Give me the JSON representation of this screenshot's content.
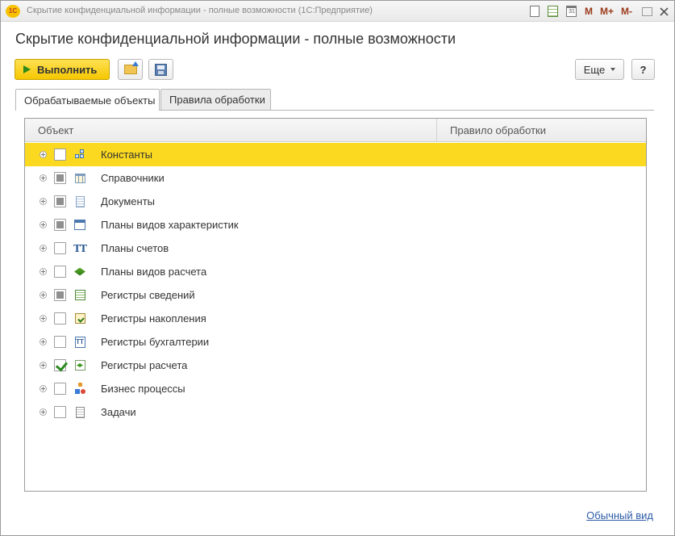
{
  "window": {
    "app_logo": "1C",
    "title": "Скрытие конфиденциальной информации - полные возможности  (1С:Предприятие)",
    "controls": {
      "mem": "M",
      "mem_plus": "M+",
      "mem_minus": "M-"
    }
  },
  "page": {
    "title": "Скрытие конфиденциальной информации - полные возможности"
  },
  "toolbar": {
    "run_label": "Выполнить",
    "more_label": "Еще",
    "help_label": "?"
  },
  "tabs": [
    {
      "label": "Обрабатываемые объекты",
      "active": true
    },
    {
      "label": "Правила обработки",
      "active": false
    }
  ],
  "grid": {
    "columns": [
      "Объект",
      "Правило обработки"
    ],
    "rows": [
      {
        "label": "Константы",
        "check": "unchecked",
        "icon": "constants-icon",
        "selected": true
      },
      {
        "label": "Справочники",
        "check": "partial",
        "icon": "catalogs-icon",
        "selected": false
      },
      {
        "label": "Документы",
        "check": "partial",
        "icon": "documents-icon",
        "selected": false
      },
      {
        "label": "Планы видов характеристик",
        "check": "partial",
        "icon": "characteristic-types-icon",
        "selected": false
      },
      {
        "label": "Планы счетов",
        "check": "unchecked",
        "icon": "chart-of-accounts-icon",
        "selected": false
      },
      {
        "label": "Планы видов расчета",
        "check": "unchecked",
        "icon": "calculation-types-icon",
        "selected": false
      },
      {
        "label": "Регистры сведений",
        "check": "partial",
        "icon": "information-registers-icon",
        "selected": false
      },
      {
        "label": "Регистры накопления",
        "check": "unchecked",
        "icon": "accumulation-registers-icon",
        "selected": false
      },
      {
        "label": "Регистры бухгалтерии",
        "check": "unchecked",
        "icon": "accounting-registers-icon",
        "selected": false
      },
      {
        "label": "Регистры расчета",
        "check": "checked",
        "icon": "calculation-registers-icon",
        "selected": false
      },
      {
        "label": "Бизнес процессы",
        "check": "unchecked",
        "icon": "business-processes-icon",
        "selected": false
      },
      {
        "label": "Задачи",
        "check": "unchecked",
        "icon": "tasks-icon",
        "selected": false
      }
    ]
  },
  "footer": {
    "link_label": "Обычный вид"
  },
  "colors": {
    "accent_yellow": "#fbd920",
    "link_blue": "#2b5ba6",
    "check_green": "#2b8a1f"
  }
}
